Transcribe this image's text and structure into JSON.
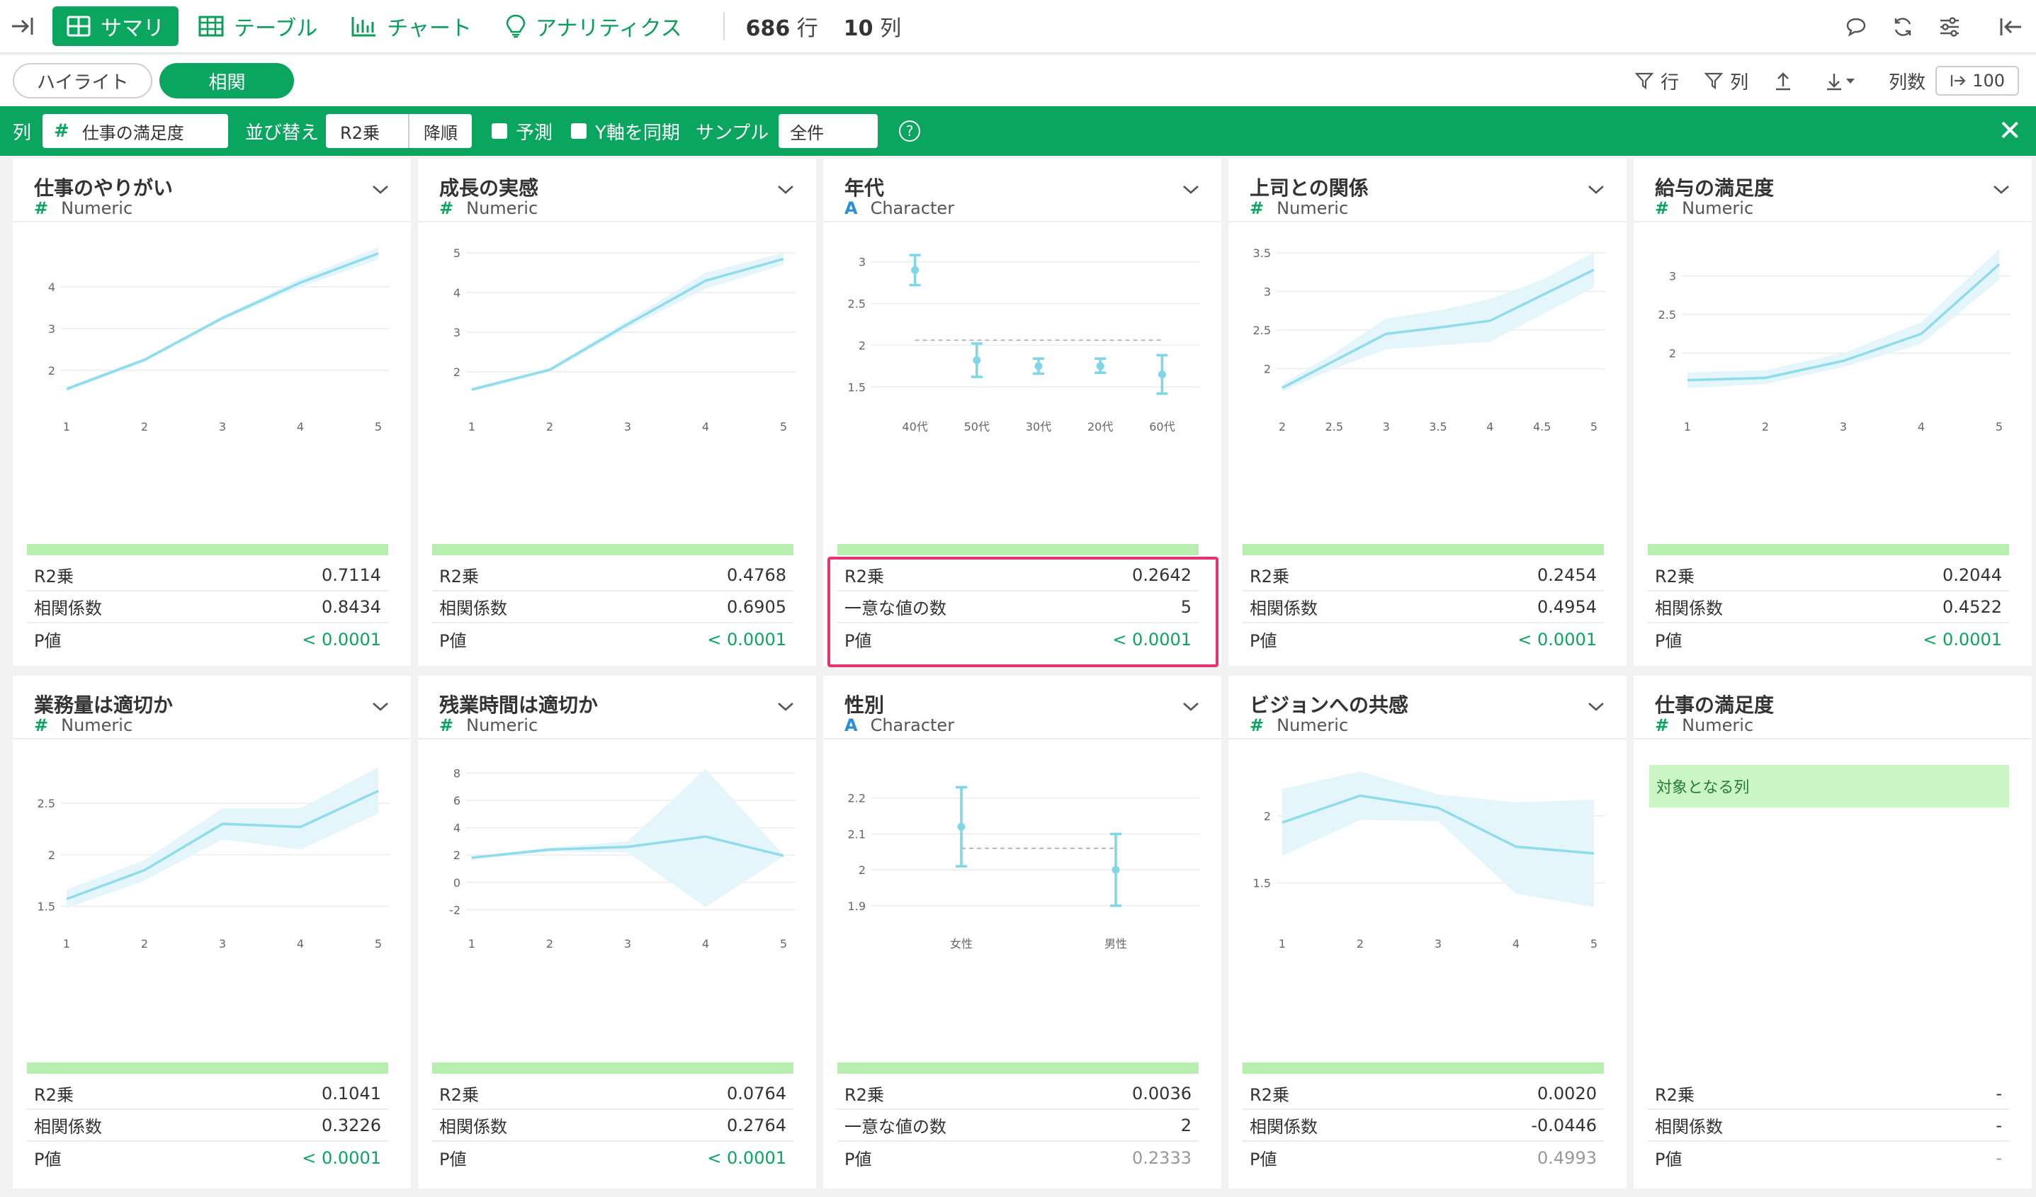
{
  "topbar": {
    "tabs": [
      {
        "label": "サマリ",
        "icon": "summary-grid-icon",
        "active": true
      },
      {
        "label": "テーブル",
        "icon": "table-icon",
        "active": false
      },
      {
        "label": "チャート",
        "icon": "bar-chart-icon",
        "active": false
      },
      {
        "label": "アナリティクス",
        "icon": "lightbulb-icon",
        "active": false
      }
    ],
    "rows": "686",
    "rows_unit": "行",
    "cols": "10",
    "cols_unit": "列"
  },
  "subbar": {
    "highlight_label": "ハイライト",
    "correlation_label": "相関",
    "row_filter": "行",
    "col_filter": "列",
    "column_count_label": "列数",
    "column_count_value": "100"
  },
  "corrbar": {
    "column_label": "列",
    "column_value": "仕事の満足度",
    "sort_label": "並び替え",
    "sort_by": "R2乗",
    "sort_order": "降順",
    "predict_label": "予測",
    "sync_y_label": "Y軸を同期",
    "sample_label": "サンプル",
    "sample_value": "全件"
  },
  "colors": {
    "accent": "#0aa660",
    "line": "#8fdcec",
    "band": "#e4f5fb",
    "highlight": "#e8336c"
  },
  "cards": [
    {
      "title": "仕事のやりがい",
      "type": "Numeric",
      "stats": [
        [
          "R2乗",
          "0.7114",
          ""
        ],
        [
          "相関係数",
          "0.8434",
          ""
        ],
        [
          "P値",
          "< 0.0001",
          "g"
        ]
      ]
    },
    {
      "title": "成長の実感",
      "type": "Numeric",
      "stats": [
        [
          "R2乗",
          "0.4768",
          ""
        ],
        [
          "相関係数",
          "0.6905",
          ""
        ],
        [
          "P値",
          "< 0.0001",
          "g"
        ]
      ]
    },
    {
      "title": "年代",
      "type": "Character",
      "stats": [
        [
          "R2乗",
          "0.2642",
          ""
        ],
        [
          "一意な値の数",
          "5",
          ""
        ],
        [
          "P値",
          "< 0.0001",
          "g"
        ]
      ]
    },
    {
      "title": "上司との関係",
      "type": "Numeric",
      "stats": [
        [
          "R2乗",
          "0.2454",
          ""
        ],
        [
          "相関係数",
          "0.4954",
          ""
        ],
        [
          "P値",
          "< 0.0001",
          "g"
        ]
      ]
    },
    {
      "title": "給与の満足度",
      "type": "Numeric",
      "stats": [
        [
          "R2乗",
          "0.2044",
          ""
        ],
        [
          "相関係数",
          "0.4522",
          ""
        ],
        [
          "P値",
          "< 0.0001",
          "g"
        ]
      ]
    },
    {
      "title": "業務量は適切か",
      "type": "Numeric",
      "stats": [
        [
          "R2乗",
          "0.1041",
          ""
        ],
        [
          "相関係数",
          "0.3226",
          ""
        ],
        [
          "P値",
          "< 0.0001",
          "g"
        ]
      ]
    },
    {
      "title": "残業時間は適切か",
      "type": "Numeric",
      "stats": [
        [
          "R2乗",
          "0.0764",
          ""
        ],
        [
          "相関係数",
          "0.2764",
          ""
        ],
        [
          "P値",
          "< 0.0001",
          "g"
        ]
      ]
    },
    {
      "title": "性別",
      "type": "Character",
      "stats": [
        [
          "R2乗",
          "0.0036",
          ""
        ],
        [
          "一意な値の数",
          "2",
          ""
        ],
        [
          "P値",
          "0.2333",
          "gray"
        ]
      ]
    },
    {
      "title": "ビジョンへの共感",
      "type": "Numeric",
      "stats": [
        [
          "R2乗",
          "0.0020",
          ""
        ],
        [
          "相関係数",
          "-0.0446",
          ""
        ],
        [
          "P値",
          "0.4993",
          "gray"
        ]
      ]
    },
    {
      "title": "仕事の満足度",
      "type": "Numeric",
      "target_label": "対象となる列",
      "stats": [
        [
          "R2乗",
          "-",
          ""
        ],
        [
          "相関係数",
          "-",
          ""
        ],
        [
          "P値",
          "-",
          "gray"
        ]
      ]
    }
  ],
  "chart_data": [
    {
      "type": "line",
      "x": [
        1,
        2,
        3,
        4,
        5
      ],
      "y": [
        1.55,
        2.25,
        3.25,
        4.1,
        4.8
      ],
      "lo": [
        1.5,
        2.2,
        3.2,
        4.0,
        4.65
      ],
      "hi": [
        1.6,
        2.3,
        3.3,
        4.2,
        4.95
      ],
      "xlim": [
        1,
        5
      ],
      "ylim": [
        1.3,
        5.0
      ],
      "xticks": [
        "1",
        "2",
        "3",
        "4",
        "5"
      ],
      "yticks": [
        2,
        3,
        4
      ]
    },
    {
      "type": "line",
      "x": [
        1,
        2,
        3,
        4,
        5
      ],
      "y": [
        1.55,
        2.05,
        3.2,
        4.3,
        4.85
      ],
      "lo": [
        1.5,
        2.0,
        3.1,
        4.1,
        4.7
      ],
      "hi": [
        1.6,
        2.1,
        3.3,
        4.5,
        5.0
      ],
      "xlim": [
        1,
        5
      ],
      "ylim": [
        1.3,
        5.2
      ],
      "xticks": [
        "1",
        "2",
        "3",
        "4",
        "5"
      ],
      "yticks": [
        2,
        3,
        4,
        5
      ]
    },
    {
      "type": "errorbar",
      "categories": [
        "40代",
        "50代",
        "30代",
        "20代",
        "60代"
      ],
      "mean": [
        2.9,
        1.82,
        1.75,
        1.75,
        1.65
      ],
      "lo": [
        2.72,
        1.62,
        1.66,
        1.67,
        1.42
      ],
      "hi": [
        3.08,
        2.02,
        1.84,
        1.84,
        1.88
      ],
      "ref": 2.06,
      "ylim": [
        1.35,
        3.2
      ],
      "yticks": [
        1.5,
        2,
        2.5,
        3
      ]
    },
    {
      "type": "line",
      "x": [
        2,
        2.5,
        3,
        3.5,
        4,
        4.5,
        5
      ],
      "y": [
        1.75,
        2.1,
        2.45,
        2.53,
        2.62,
        2.95,
        3.28
      ],
      "lo": [
        1.7,
        2.0,
        2.25,
        2.3,
        2.35,
        2.7,
        3.05
      ],
      "hi": [
        1.8,
        2.2,
        2.65,
        2.75,
        2.9,
        3.15,
        3.5
      ],
      "xlim": [
        2,
        5
      ],
      "ylim": [
        1.6,
        3.6
      ],
      "xticks": [
        "2",
        "2.5",
        "3",
        "3.5",
        "4",
        "4.5",
        "5"
      ],
      "yticks": [
        2,
        2.5,
        3,
        3.5
      ]
    },
    {
      "type": "line",
      "x": [
        1,
        2,
        3,
        4,
        5
      ],
      "y": [
        1.65,
        1.68,
        1.9,
        2.25,
        3.15
      ],
      "lo": [
        1.55,
        1.6,
        1.82,
        2.12,
        2.95
      ],
      "hi": [
        1.75,
        1.78,
        2.0,
        2.4,
        3.35
      ],
      "xlim": [
        1,
        5
      ],
      "ylim": [
        1.4,
        3.4
      ],
      "xticks": [
        "1",
        "2",
        "3",
        "4",
        "5"
      ],
      "yticks": [
        2,
        2.5,
        3
      ]
    },
    {
      "type": "line",
      "x": [
        1,
        2,
        3,
        4,
        5
      ],
      "y": [
        1.57,
        1.85,
        2.3,
        2.27,
        2.62
      ],
      "lo": [
        1.48,
        1.75,
        2.15,
        2.05,
        2.4
      ],
      "hi": [
        1.66,
        1.95,
        2.45,
        2.45,
        2.85
      ],
      "xlim": [
        1,
        5
      ],
      "ylim": [
        1.4,
        2.9
      ],
      "xticks": [
        "1",
        "2",
        "3",
        "4",
        "5"
      ],
      "yticks": [
        1.5,
        2,
        2.5
      ]
    },
    {
      "type": "line",
      "x": [
        1,
        2,
        3,
        4,
        5
      ],
      "y": [
        1.8,
        2.4,
        2.6,
        3.35,
        1.95
      ],
      "lo": [
        1.7,
        2.25,
        2.2,
        -1.8,
        1.9
      ],
      "hi": [
        1.9,
        2.55,
        3.0,
        8.3,
        2.0
      ],
      "xlim": [
        1,
        5
      ],
      "ylim": [
        -2.5,
        8.8
      ],
      "xticks": [
        "1",
        "2",
        "3",
        "4",
        "5"
      ],
      "yticks": [
        -2,
        0,
        2,
        4,
        6,
        8
      ]
    },
    {
      "type": "errorbar",
      "categories": [
        "女性",
        "男性"
      ],
      "mean": [
        2.12,
        2.0
      ],
      "lo": [
        2.01,
        1.9
      ],
      "hi": [
        2.23,
        2.1
      ],
      "ref": 2.06,
      "ylim": [
        1.87,
        2.3
      ],
      "yticks": [
        1.9,
        2,
        2.1,
        2.2
      ]
    },
    {
      "type": "line",
      "x": [
        1,
        2,
        3,
        4,
        5
      ],
      "y": [
        1.95,
        2.15,
        2.06,
        1.77,
        1.72
      ],
      "lo": [
        1.7,
        1.97,
        1.96,
        1.42,
        1.32
      ],
      "hi": [
        2.2,
        2.33,
        2.16,
        2.1,
        2.12
      ],
      "xlim": [
        1,
        5
      ],
      "ylim": [
        1.25,
        2.4
      ],
      "xticks": [
        "1",
        "2",
        "3",
        "4",
        "5"
      ],
      "yticks": [
        1.5,
        2
      ]
    }
  ]
}
